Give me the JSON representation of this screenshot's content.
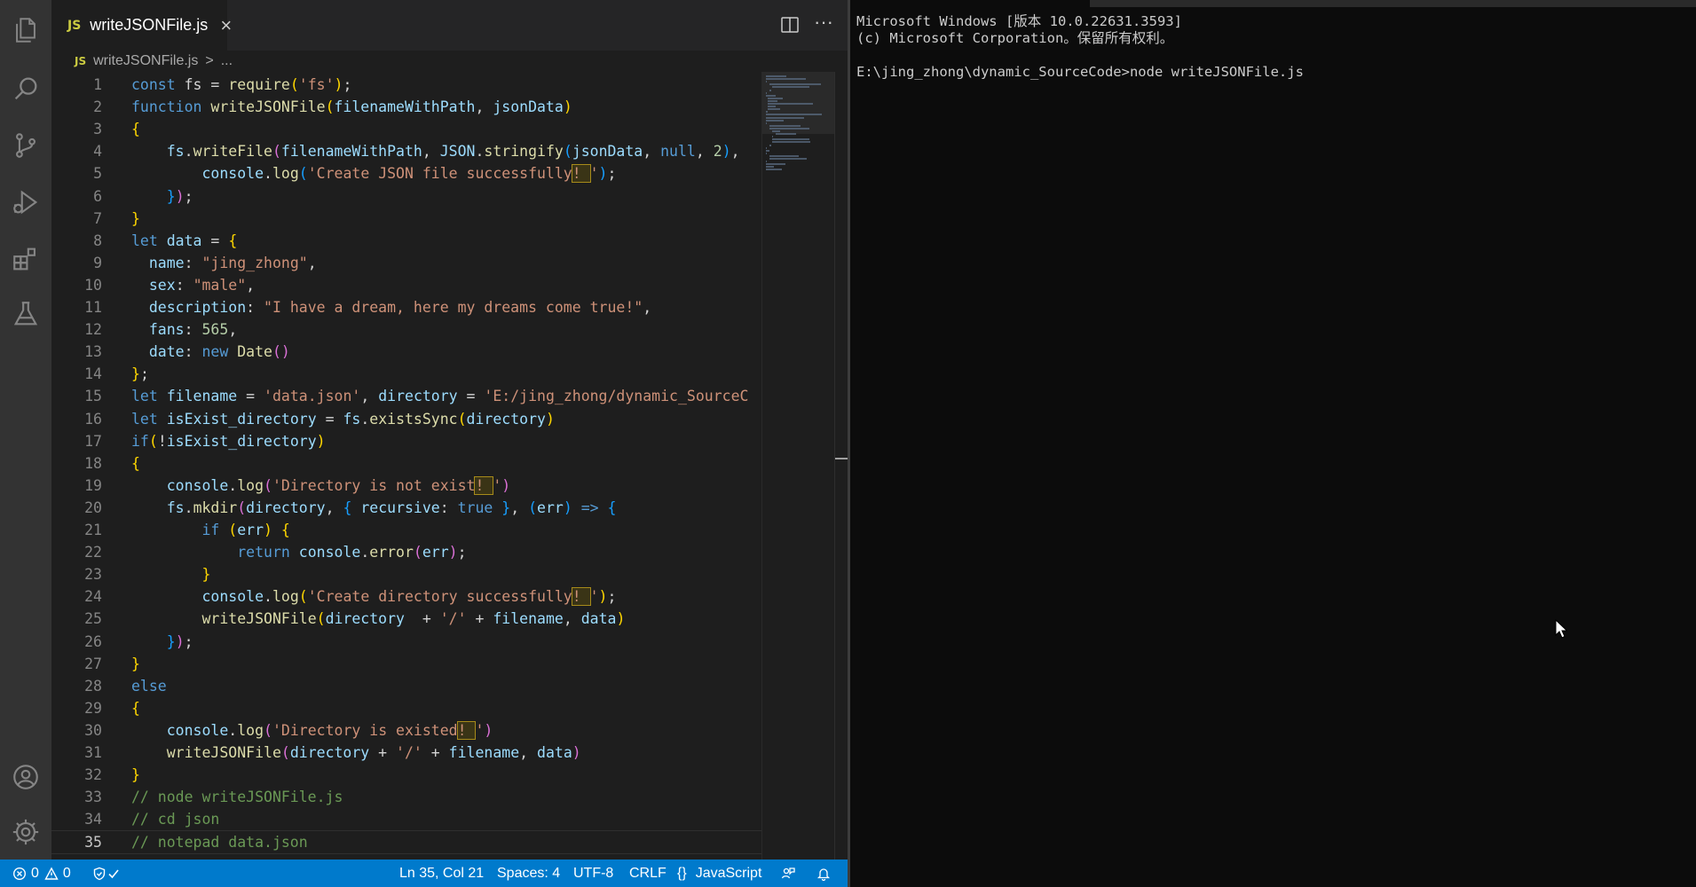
{
  "editor": {
    "tab": {
      "badge": "JS",
      "title": "writeJSONFile.js",
      "close": "×"
    },
    "breadcrumb": {
      "badge": "JS",
      "file": "writeJSONFile.js",
      "sep": ">",
      "more": "..."
    },
    "more_actions": "···",
    "lines": [
      [
        [
          "k",
          "const"
        ],
        [
          "p",
          " fs = "
        ],
        [
          "f",
          "require"
        ],
        [
          "b1",
          "("
        ],
        [
          "s",
          "'fs'"
        ],
        [
          "b1",
          ")"
        ],
        [
          "p",
          ";"
        ]
      ],
      [
        [
          "k",
          "function"
        ],
        [
          "p",
          " "
        ],
        [
          "f",
          "writeJSONFile"
        ],
        [
          "b1",
          "("
        ],
        [
          "v",
          "filenameWithPath"
        ],
        [
          "p",
          ", "
        ],
        [
          "v",
          "jsonData"
        ],
        [
          "b1",
          ")"
        ]
      ],
      [
        [
          "b1",
          "{"
        ]
      ],
      [
        [
          "p",
          "    "
        ],
        [
          "v",
          "fs"
        ],
        [
          "p",
          "."
        ],
        [
          "f",
          "writeFile"
        ],
        [
          "b2",
          "("
        ],
        [
          "v",
          "filenameWithPath"
        ],
        [
          "p",
          ", "
        ],
        [
          "v",
          "JSON"
        ],
        [
          "p",
          "."
        ],
        [
          "f",
          "stringify"
        ],
        [
          "b3",
          "("
        ],
        [
          "v",
          "jsonData"
        ],
        [
          "p",
          ", "
        ],
        [
          "k",
          "null"
        ],
        [
          "p",
          ", "
        ],
        [
          "n",
          "2"
        ],
        [
          "b3",
          ")"
        ],
        [
          "p",
          ","
        ]
      ],
      [
        [
          "p",
          "        "
        ],
        [
          "v",
          "console"
        ],
        [
          "p",
          "."
        ],
        [
          "f",
          "log"
        ],
        [
          "b3",
          "("
        ],
        [
          "s",
          "'Create JSON file successfully"
        ],
        [
          "w",
          "! "
        ],
        [
          "s",
          "'"
        ],
        [
          "b3",
          ")"
        ],
        [
          "p",
          ";"
        ]
      ],
      [
        [
          "p",
          "    "
        ],
        [
          "b3",
          "}"
        ],
        [
          "b2",
          ")"
        ],
        [
          "p",
          ";"
        ]
      ],
      [
        [
          "b1",
          "}"
        ]
      ],
      [
        [
          "k",
          "let"
        ],
        [
          "p",
          " "
        ],
        [
          "v",
          "data"
        ],
        [
          "p",
          " = "
        ],
        [
          "b1",
          "{"
        ]
      ],
      [
        [
          "p",
          "  "
        ],
        [
          "v",
          "name"
        ],
        [
          "p",
          ": "
        ],
        [
          "s",
          "\"jing_zhong\""
        ],
        [
          "p",
          ","
        ]
      ],
      [
        [
          "p",
          "  "
        ],
        [
          "v",
          "sex"
        ],
        [
          "p",
          ": "
        ],
        [
          "s",
          "\"male\""
        ],
        [
          "p",
          ","
        ]
      ],
      [
        [
          "p",
          "  "
        ],
        [
          "v",
          "description"
        ],
        [
          "p",
          ": "
        ],
        [
          "s",
          "\"I have a dream, here my dreams come true!\""
        ],
        [
          "p",
          ","
        ]
      ],
      [
        [
          "p",
          "  "
        ],
        [
          "v",
          "fans"
        ],
        [
          "p",
          ": "
        ],
        [
          "n",
          "565"
        ],
        [
          "p",
          ","
        ]
      ],
      [
        [
          "p",
          "  "
        ],
        [
          "v",
          "date"
        ],
        [
          "p",
          ": "
        ],
        [
          "k",
          "new"
        ],
        [
          "p",
          " "
        ],
        [
          "f",
          "Date"
        ],
        [
          "b2",
          "()"
        ]
      ],
      [
        [
          "b1",
          "}"
        ],
        [
          "p",
          ";"
        ]
      ],
      [
        [
          "k",
          "let"
        ],
        [
          "p",
          " "
        ],
        [
          "v",
          "filename"
        ],
        [
          "p",
          " = "
        ],
        [
          "s",
          "'data.json'"
        ],
        [
          "p",
          ", "
        ],
        [
          "v",
          "directory"
        ],
        [
          "p",
          " = "
        ],
        [
          "s",
          "'E:/jing_zhong/dynamic_SourceC"
        ]
      ],
      [
        [
          "k",
          "let"
        ],
        [
          "p",
          " "
        ],
        [
          "v",
          "isExist_directory"
        ],
        [
          "p",
          " = "
        ],
        [
          "v",
          "fs"
        ],
        [
          "p",
          "."
        ],
        [
          "f",
          "existsSync"
        ],
        [
          "b1",
          "("
        ],
        [
          "v",
          "directory"
        ],
        [
          "b1",
          ")"
        ]
      ],
      [
        [
          "k",
          "if"
        ],
        [
          "b1",
          "("
        ],
        [
          "p",
          "!"
        ],
        [
          "v",
          "isExist_directory"
        ],
        [
          "b1",
          ")"
        ]
      ],
      [
        [
          "b1",
          "{"
        ]
      ],
      [
        [
          "p",
          "    "
        ],
        [
          "v",
          "console"
        ],
        [
          "p",
          "."
        ],
        [
          "f",
          "log"
        ],
        [
          "b2",
          "("
        ],
        [
          "s",
          "'Directory is not exist"
        ],
        [
          "w",
          "! "
        ],
        [
          "s",
          "'"
        ],
        [
          "b2",
          ")"
        ]
      ],
      [
        [
          "p",
          "    "
        ],
        [
          "v",
          "fs"
        ],
        [
          "p",
          "."
        ],
        [
          "f",
          "mkdir"
        ],
        [
          "b2",
          "("
        ],
        [
          "v",
          "directory"
        ],
        [
          "p",
          ", "
        ],
        [
          "b3",
          "{"
        ],
        [
          "p",
          " "
        ],
        [
          "v",
          "recursive"
        ],
        [
          "p",
          ": "
        ],
        [
          "k",
          "true"
        ],
        [
          "p",
          " "
        ],
        [
          "b3",
          "}"
        ],
        [
          "p",
          ", "
        ],
        [
          "b3",
          "("
        ],
        [
          "v",
          "err"
        ],
        [
          "b3",
          ")"
        ],
        [
          "p",
          " "
        ],
        [
          "k",
          "=>"
        ],
        [
          "p",
          " "
        ],
        [
          "b3",
          "{"
        ]
      ],
      [
        [
          "p",
          "        "
        ],
        [
          "k",
          "if"
        ],
        [
          "p",
          " "
        ],
        [
          "b1",
          "("
        ],
        [
          "v",
          "err"
        ],
        [
          "b1",
          ")"
        ],
        [
          "p",
          " "
        ],
        [
          "b1",
          "{"
        ]
      ],
      [
        [
          "p",
          "            "
        ],
        [
          "k",
          "return"
        ],
        [
          "p",
          " "
        ],
        [
          "v",
          "console"
        ],
        [
          "p",
          "."
        ],
        [
          "f",
          "error"
        ],
        [
          "b2",
          "("
        ],
        [
          "v",
          "err"
        ],
        [
          "b2",
          ")"
        ],
        [
          "p",
          ";"
        ]
      ],
      [
        [
          "p",
          "        "
        ],
        [
          "b1",
          "}"
        ]
      ],
      [
        [
          "p",
          "        "
        ],
        [
          "v",
          "console"
        ],
        [
          "p",
          "."
        ],
        [
          "f",
          "log"
        ],
        [
          "b1",
          "("
        ],
        [
          "s",
          "'Create directory successfully"
        ],
        [
          "w",
          "! "
        ],
        [
          "s",
          "'"
        ],
        [
          "b1",
          ")"
        ],
        [
          "p",
          ";"
        ]
      ],
      [
        [
          "p",
          "        "
        ],
        [
          "f",
          "writeJSONFile"
        ],
        [
          "b1",
          "("
        ],
        [
          "v",
          "directory"
        ],
        [
          "p",
          "  + "
        ],
        [
          "s",
          "'/'"
        ],
        [
          "p",
          " + "
        ],
        [
          "v",
          "filename"
        ],
        [
          "p",
          ", "
        ],
        [
          "v",
          "data"
        ],
        [
          "b1",
          ")"
        ]
      ],
      [
        [
          "p",
          "    "
        ],
        [
          "b3",
          "}"
        ],
        [
          "b2",
          ")"
        ],
        [
          "p",
          ";"
        ]
      ],
      [
        [
          "b1",
          "}"
        ]
      ],
      [
        [
          "k",
          "else"
        ]
      ],
      [
        [
          "b1",
          "{"
        ]
      ],
      [
        [
          "p",
          "    "
        ],
        [
          "v",
          "console"
        ],
        [
          "p",
          "."
        ],
        [
          "f",
          "log"
        ],
        [
          "b2",
          "("
        ],
        [
          "s",
          "'Directory is existed"
        ],
        [
          "w",
          "! "
        ],
        [
          "s",
          "'"
        ],
        [
          "b2",
          ")"
        ]
      ],
      [
        [
          "p",
          "    "
        ],
        [
          "f",
          "writeJSONFile"
        ],
        [
          "b2",
          "("
        ],
        [
          "v",
          "directory"
        ],
        [
          "p",
          " + "
        ],
        [
          "s",
          "'/'"
        ],
        [
          "p",
          " + "
        ],
        [
          "v",
          "filename"
        ],
        [
          "p",
          ", "
        ],
        [
          "v",
          "data"
        ],
        [
          "b2",
          ")"
        ]
      ],
      [
        [
          "b1",
          "}"
        ]
      ],
      [
        [
          "c",
          "// node writeJSONFile.js"
        ]
      ],
      [
        [
          "c",
          "// cd json"
        ]
      ],
      [
        [
          "c",
          "// notepad data.json"
        ]
      ]
    ],
    "current_line": 35
  },
  "status": {
    "errors": "0",
    "warnings": "0",
    "position": "Ln 35, Col 21",
    "spaces": "Spaces: 4",
    "encoding": "UTF-8",
    "eol": "CRLF",
    "language_glyph": "{}",
    "language": "JavaScript"
  },
  "terminal": {
    "lines": [
      "Microsoft Windows [版本 10.0.22631.3593]",
      "(c) Microsoft Corporation。保留所有权利。",
      "",
      "E:\\jing_zhong\\dynamic_SourceCode>node writeJSONFile.js"
    ]
  },
  "colors": {
    "status_bar": "#007acc",
    "editor_bg": "#1e1e1e",
    "terminal_bg": "#0c0c0c"
  }
}
